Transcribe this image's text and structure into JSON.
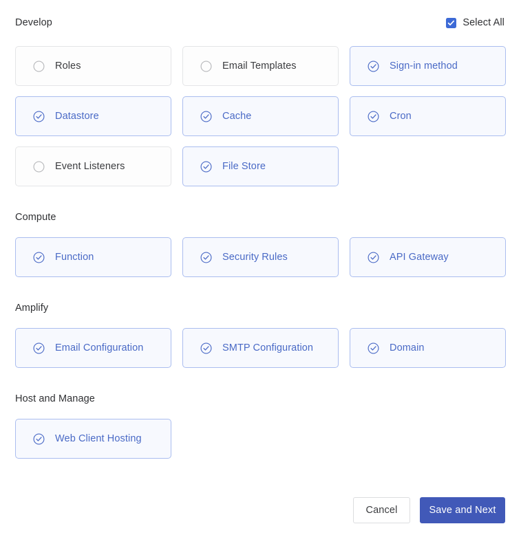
{
  "select_all": {
    "label": "Select All",
    "checked": true,
    "icon": "checkbox-checked-icon"
  },
  "theme": {
    "accent": "#4159b8",
    "selected_border": "#aabdef",
    "selected_bg": "#f7f9fe",
    "selected_text": "#4a6ac6",
    "unselected_border": "#e4e5e7",
    "unselected_bg": "#fdfdfd",
    "unselected_text": "#3b3c3f",
    "heading_text": "#2f3033",
    "checkbox_fill": "#3d6ad6"
  },
  "sections": [
    {
      "title": "Develop",
      "items": [
        {
          "label": "Roles",
          "selected": false,
          "icon": "circle-empty-icon"
        },
        {
          "label": "Email Templates",
          "selected": false,
          "icon": "circle-empty-icon"
        },
        {
          "label": "Sign-in method",
          "selected": true,
          "icon": "circle-check-icon"
        },
        {
          "label": "Datastore",
          "selected": true,
          "icon": "circle-check-icon"
        },
        {
          "label": "Cache",
          "selected": true,
          "icon": "circle-check-icon"
        },
        {
          "label": "Cron",
          "selected": true,
          "icon": "circle-check-icon"
        },
        {
          "label": "Event Listeners",
          "selected": false,
          "icon": "circle-empty-icon"
        },
        {
          "label": "File Store",
          "selected": true,
          "icon": "circle-check-icon"
        }
      ]
    },
    {
      "title": "Compute",
      "items": [
        {
          "label": "Function",
          "selected": true,
          "icon": "circle-check-icon"
        },
        {
          "label": "Security Rules",
          "selected": true,
          "icon": "circle-check-icon"
        },
        {
          "label": "API Gateway",
          "selected": true,
          "icon": "circle-check-icon"
        }
      ]
    },
    {
      "title": "Amplify",
      "items": [
        {
          "label": "Email Configuration",
          "selected": true,
          "icon": "circle-check-icon"
        },
        {
          "label": "SMTP Configuration",
          "selected": true,
          "icon": "circle-check-icon"
        },
        {
          "label": "Domain",
          "selected": true,
          "icon": "circle-check-icon"
        }
      ]
    },
    {
      "title": "Host and Manage",
      "items": [
        {
          "label": "Web Client Hosting",
          "selected": true,
          "icon": "circle-check-icon"
        }
      ]
    }
  ],
  "footer": {
    "cancel_label": "Cancel",
    "save_label": "Save and Next"
  }
}
